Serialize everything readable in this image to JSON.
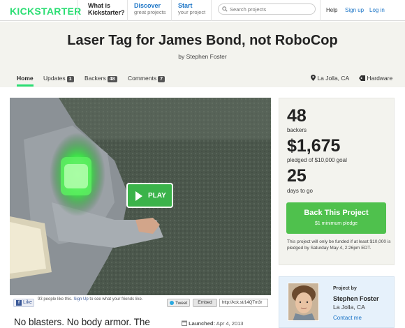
{
  "nav": {
    "logo": "KICKSTARTER",
    "what_is_main": "What is",
    "what_is_sub": "Kickstarter?",
    "discover_main": "Discover",
    "discover_sub": "great projects",
    "start_main": "Start",
    "start_sub": "your project",
    "search_placeholder": "Search projects",
    "help": "Help",
    "sign_up": "Sign up",
    "log_in": "Log in"
  },
  "project": {
    "title": "Laser Tag for James Bond, not RoboCop",
    "byline": "by Stephen Foster"
  },
  "tabs": [
    {
      "label": "Home"
    },
    {
      "label": "Updates",
      "count": "1"
    },
    {
      "label": "Backers",
      "count": "48"
    },
    {
      "label": "Comments",
      "count": "7"
    }
  ],
  "location": "La Jolla, CA",
  "category": "Hardware",
  "video": {
    "play_label": "PLAY"
  },
  "social": {
    "like_label": "Like",
    "like_text_a": "93 people like this.",
    "like_text_link": "Sign Up",
    "like_text_b": "to see what your friends like.",
    "tweet_label": "Tweet",
    "embed_label": "Embed",
    "short_url": "http://kck.st/14QTm3r"
  },
  "blurb": "No blasters. No body armor. The",
  "launched_label": "Launched:",
  "launched_date": "Apr 4, 2013",
  "stats": {
    "backers_num": "48",
    "backers_label": "backers",
    "pledged_num": "$1,675",
    "pledged_label": "pledged of $10,000 goal",
    "days_num": "25",
    "days_label": "days to go",
    "back_button": "Back This Project",
    "min_pledge": "$1 minimum pledge",
    "funding_note": "This project will only be funded if at least $10,000 is pledged by Saturday May 4, 2:26pm EDT."
  },
  "creator": {
    "project_by": "Project by",
    "name": "Stephen Foster",
    "location": "La Jolla, CA",
    "contact": "Contact me"
  },
  "colors": {
    "brand_green": "#2bde73",
    "button_green": "#4fc14d",
    "link_blue": "#1a74c6",
    "band_bg": "#f3f3ee"
  }
}
